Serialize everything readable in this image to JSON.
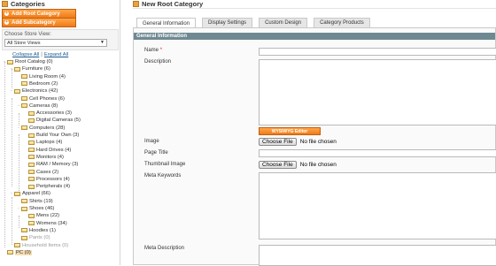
{
  "sidebar": {
    "title": "Categories",
    "add_root_label": "Add Root Category",
    "add_sub_label": "Add Subcategory",
    "store_label": "Choose Store View:",
    "store_value": "All Store Views",
    "collapse_label": "Collapse All",
    "separator": "|",
    "expand_label": "Expand All"
  },
  "tree": [
    {
      "label": "Root Catalog (0)",
      "depth": 0,
      "toggle": "-"
    },
    {
      "label": "Furniture (6)",
      "depth": 1,
      "toggle": "-"
    },
    {
      "label": "Living Room (4)",
      "depth": 2,
      "toggle": ""
    },
    {
      "label": "Bedroom (2)",
      "depth": 2,
      "toggle": ""
    },
    {
      "label": "Electronics (42)",
      "depth": 1,
      "toggle": "-"
    },
    {
      "label": "Cell Phones (6)",
      "depth": 2,
      "toggle": ""
    },
    {
      "label": "Cameras (8)",
      "depth": 2,
      "toggle": "-"
    },
    {
      "label": "Accessories (3)",
      "depth": 3,
      "toggle": ""
    },
    {
      "label": "Digital Cameras (5)",
      "depth": 3,
      "toggle": ""
    },
    {
      "label": "Computers (28)",
      "depth": 2,
      "toggle": "-"
    },
    {
      "label": "Build Your Own (3)",
      "depth": 3,
      "toggle": ""
    },
    {
      "label": "Laptops (4)",
      "depth": 3,
      "toggle": ""
    },
    {
      "label": "Hard Drives (4)",
      "depth": 3,
      "toggle": ""
    },
    {
      "label": "Monitors (4)",
      "depth": 3,
      "toggle": ""
    },
    {
      "label": "RAM / Memory (3)",
      "depth": 3,
      "toggle": ""
    },
    {
      "label": "Cases (2)",
      "depth": 3,
      "toggle": ""
    },
    {
      "label": "Processors (4)",
      "depth": 3,
      "toggle": ""
    },
    {
      "label": "Peripherals (4)",
      "depth": 3,
      "toggle": ""
    },
    {
      "label": "Apparel (66)",
      "depth": 1,
      "toggle": "-"
    },
    {
      "label": "Shirts (19)",
      "depth": 2,
      "toggle": ""
    },
    {
      "label": "Shoes (46)",
      "depth": 2,
      "toggle": "-"
    },
    {
      "label": "Mens (22)",
      "depth": 3,
      "toggle": ""
    },
    {
      "label": "Womens (34)",
      "depth": 3,
      "toggle": ""
    },
    {
      "label": "Hoodies (1)",
      "depth": 2,
      "toggle": ""
    },
    {
      "label": "Pants (0)",
      "depth": 2,
      "toggle": "",
      "dim": true
    },
    {
      "label": "Household Items (0)",
      "depth": 1,
      "toggle": "",
      "dim": true
    },
    {
      "label": "PC (0)",
      "depth": 0,
      "toggle": "",
      "selected": true
    }
  ],
  "main": {
    "title": "New Root Category",
    "tabs": [
      "General Information",
      "Display Settings",
      "Custom Design",
      "Category Products"
    ],
    "section_title": "General Information",
    "fields": {
      "name_label": "Name",
      "required_mark": "*",
      "description_label": "Description",
      "wysiwyg_label": "WYSIWYG Editor",
      "image_label": "Image",
      "page_title_label": "Page Title",
      "thumbnail_label": "Thumbnail Image",
      "meta_keywords_label": "Meta Keywords",
      "meta_description_label": "Meta Description",
      "choose_file_label": "Choose File",
      "no_file_label": "No file chosen"
    }
  },
  "colors": {
    "accent_orange": "#f07a18",
    "section_header": "#6f8992",
    "link": "#1e5a92"
  }
}
